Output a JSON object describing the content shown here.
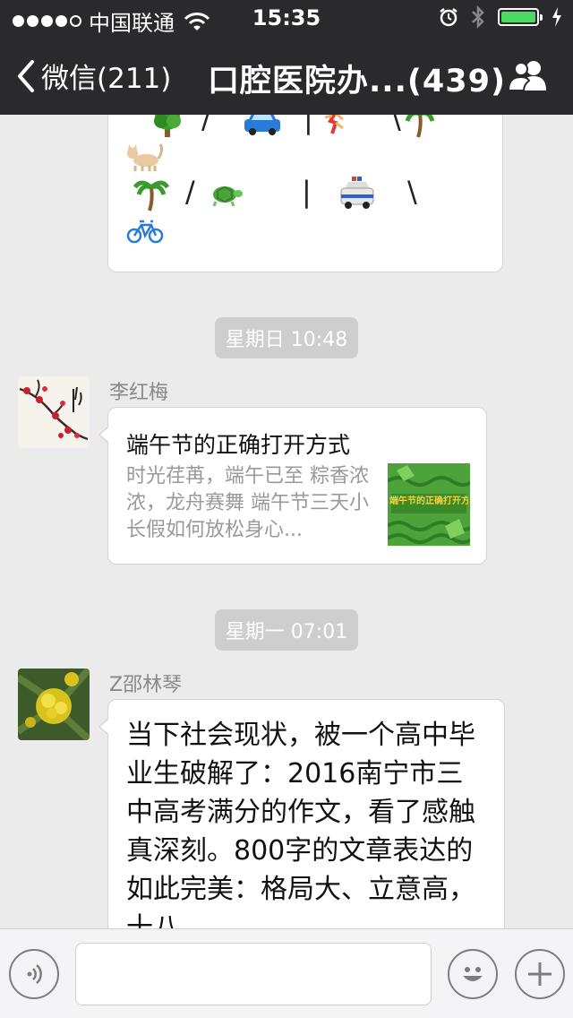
{
  "status_bar": {
    "carrier": "中国联通",
    "time": "15:35"
  },
  "nav": {
    "back_label": "微信(211)",
    "title": "口腔医院办...(439)"
  },
  "emoji_message": {
    "line1_icons": [
      "tree-icon",
      "car-icon",
      "runner-icon",
      "palm-icon"
    ],
    "line2_icons": [
      "cat-icon"
    ],
    "line3_icons": [
      "palm-icon",
      "turtle-icon",
      "police-car-icon"
    ],
    "line4_icons": [
      "bicycle-icon"
    ],
    "slash": "/",
    "bar": "|",
    "backslash": "\\"
  },
  "messages": [
    {
      "timestamp": "星期日 10:48",
      "sender": "李红梅",
      "type": "link",
      "title": "端午节的正确打开方式",
      "description": "时光荏苒，端午已至 粽香浓浓，龙舟赛舞 端午节三天小长假如何放松身心...",
      "thumbnail_text": "端午节的正确打开方式"
    },
    {
      "timestamp": "星期一 07:01",
      "sender": "Z邵林琴",
      "type": "text",
      "text": "当下社会现状，被一个高中毕业生破解了：2016南宁市三中高考满分的作文，看了感触真深刻。800字的文章表达的如此完美：格局大、立意高，十八"
    }
  ],
  "input_bar": {
    "left_icon": "voice-icon",
    "emoji_icon": "smiley-icon",
    "plus_icon": "plus-icon"
  },
  "colors": {
    "nav_bg": "#2a2a2e",
    "chat_bg": "#ebebeb",
    "battery": "#4cd964"
  }
}
